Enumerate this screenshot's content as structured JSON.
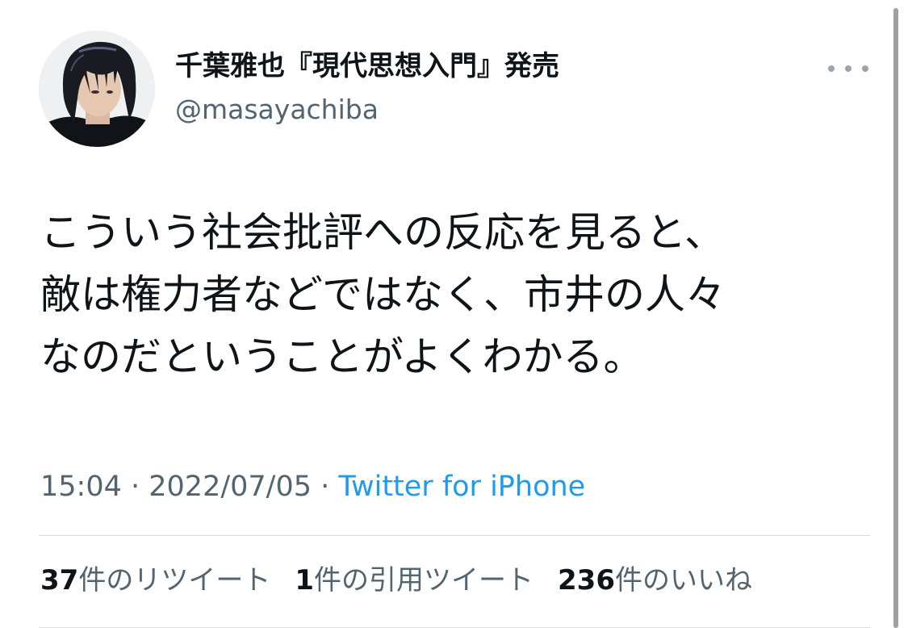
{
  "user": {
    "display_name": "千葉雅也『現代思想入門』発売",
    "handle": "@masayachiba"
  },
  "tweet": {
    "lines": [
      "こういう社会批評への反応を見ると、",
      "敵は権力者などではなく、市井の人々",
      "なのだということがよくわかる。"
    ]
  },
  "meta": {
    "time": "15:04",
    "separator": " · ",
    "date": "2022/07/05",
    "source": "Twitter for iPhone"
  },
  "stats": {
    "retweets_count": "37",
    "retweets_label": "件のリツイート",
    "quotes_count": "1",
    "quotes_label": "件の引用ツイート",
    "likes_count": "236",
    "likes_label": "件のいいね"
  },
  "icons": {
    "more": "more-horizontal-icon"
  },
  "colors": {
    "text_primary": "#0f1419",
    "text_secondary": "#536471",
    "link": "#1d9bf0",
    "divider": "#d5dade"
  }
}
